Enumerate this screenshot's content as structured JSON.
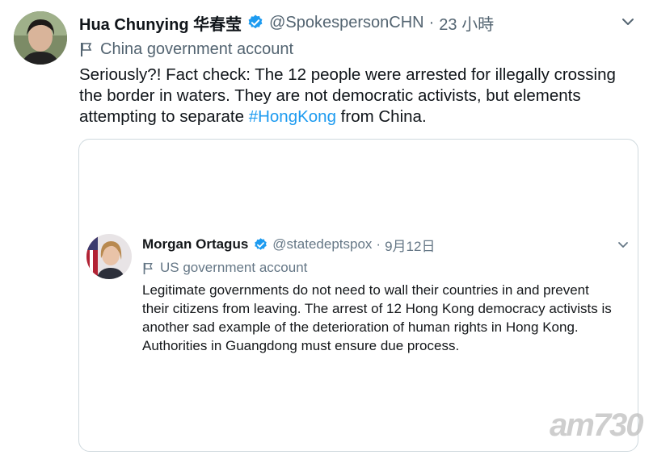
{
  "tweet": {
    "author_name": "Hua Chunying 华春莹",
    "handle": "@SpokespersonCHN",
    "separator": "·",
    "time": "23 小時",
    "account_label": "China government account",
    "text_before": "Seriously?! Fact check: The 12 people were arrested for illegally crossing the border in waters. They are not democratic activists, but elements attempting to separate ",
    "hashtag": "#HongKong",
    "text_after": " from China."
  },
  "quoted_tweet": {
    "author_name": "Morgan Ortagus",
    "handle": "@statedeptspox",
    "separator": "·",
    "time": "9月12日",
    "account_label": "US government account",
    "text": "Legitimate governments do not need to wall their countries in and prevent their citizens from leaving. The arrest of 12 Hong Kong democracy activists is another sad example of the deterioration of human rights in Hong Kong. Authorities in Guangdong must ensure due process."
  },
  "watermark": "am730",
  "colors": {
    "verified": "#1d9bf0",
    "hashtag": "#1d9bf0",
    "secondary_text": "#536471"
  }
}
